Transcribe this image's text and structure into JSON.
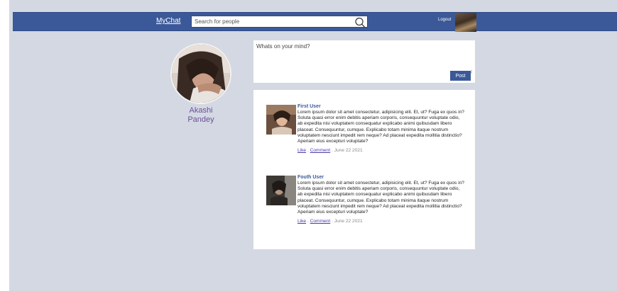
{
  "navbar": {
    "brand": "MyChat",
    "search_placeholder": "Search for people",
    "logout_label": "Logout"
  },
  "profile": {
    "first_name": "Akashi",
    "last_name": "Pandey"
  },
  "composer": {
    "placeholder": "Whats on your mind?",
    "post_label": "Post"
  },
  "feed": {
    "posts": [
      {
        "author": "First User",
        "text": "Lorem ipsum dolor sit amet consectetur, adipisicing elit. Et, ut? Fuga ex quos in? Soluta quasi error enim debitis aperiam corporis, consequuntur voluptate odio, ab expedita nisi voluptatem consequatur explicabo animi quibusdam libero placeat. Consequuntur, cumque. Explicabo totam minima itaque nostrum voluptatem nesciunt impedit rem neque? Ad placeat expedita mollitia distinctio? Aperiam eius excepturi voluptate?",
        "like_label": "Like",
        "comment_label": "Comment",
        "date": "June 22 2021"
      },
      {
        "author": "Fouth User",
        "text": "Lorem ipsum dolor sit amet consectetur, adipisicing elit. Et, ut? Fuga ex quos in? Soluta quasi error enim debitis aperiam corporis, consequuntur voluptate odio, ab expedita nisi voluptatem consequatur explicabo animi quibusdam libero placeat. Consequuntur, cumque. Explicabo totam minima itaque nostrum voluptatem nesciunt impedit rem neque? Ad placeat expedita mollitia distinctio? Aperiam eius excepturi voluptate?",
        "like_label": "Like",
        "comment_label": "Comment",
        "date": "June 22 2021"
      }
    ]
  },
  "colors": {
    "nav": "#3b5998",
    "background": "#d3d8e2",
    "name": "#6c4f9c"
  }
}
